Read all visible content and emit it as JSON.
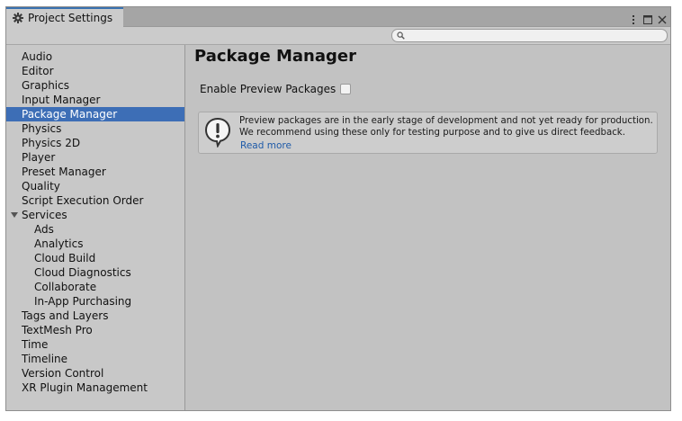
{
  "window": {
    "tab_title": "Project Settings"
  },
  "search": {
    "placeholder": ""
  },
  "sidebar": {
    "items": [
      {
        "label": "Audio"
      },
      {
        "label": "Editor"
      },
      {
        "label": "Graphics"
      },
      {
        "label": "Input Manager"
      },
      {
        "label": "Package Manager",
        "selected": true
      },
      {
        "label": "Physics"
      },
      {
        "label": "Physics 2D"
      },
      {
        "label": "Player"
      },
      {
        "label": "Preset Manager"
      },
      {
        "label": "Quality"
      },
      {
        "label": "Script Execution Order"
      },
      {
        "label": "Services",
        "expanded": true
      },
      {
        "label": "Ads",
        "sub": true
      },
      {
        "label": "Analytics",
        "sub": true
      },
      {
        "label": "Cloud Build",
        "sub": true
      },
      {
        "label": "Cloud Diagnostics",
        "sub": true
      },
      {
        "label": "Collaborate",
        "sub": true
      },
      {
        "label": "In-App Purchasing",
        "sub": true
      },
      {
        "label": "Tags and Layers"
      },
      {
        "label": "TextMesh Pro"
      },
      {
        "label": "Time"
      },
      {
        "label": "Timeline"
      },
      {
        "label": "Version Control"
      },
      {
        "label": "XR Plugin Management"
      }
    ]
  },
  "main": {
    "title": "Package Manager",
    "preview_label": "Enable Preview Packages",
    "preview_checked": false,
    "help": {
      "line1": "Preview packages are in the early stage of development and not yet ready for production.",
      "line2": "We recommend using these only for testing purpose and to give us direct feedback.",
      "read_more": "Read more"
    }
  },
  "colors": {
    "selection": "#3d6eb6",
    "link": "#1e5aa8",
    "tab_accent": "#3a72b0"
  }
}
